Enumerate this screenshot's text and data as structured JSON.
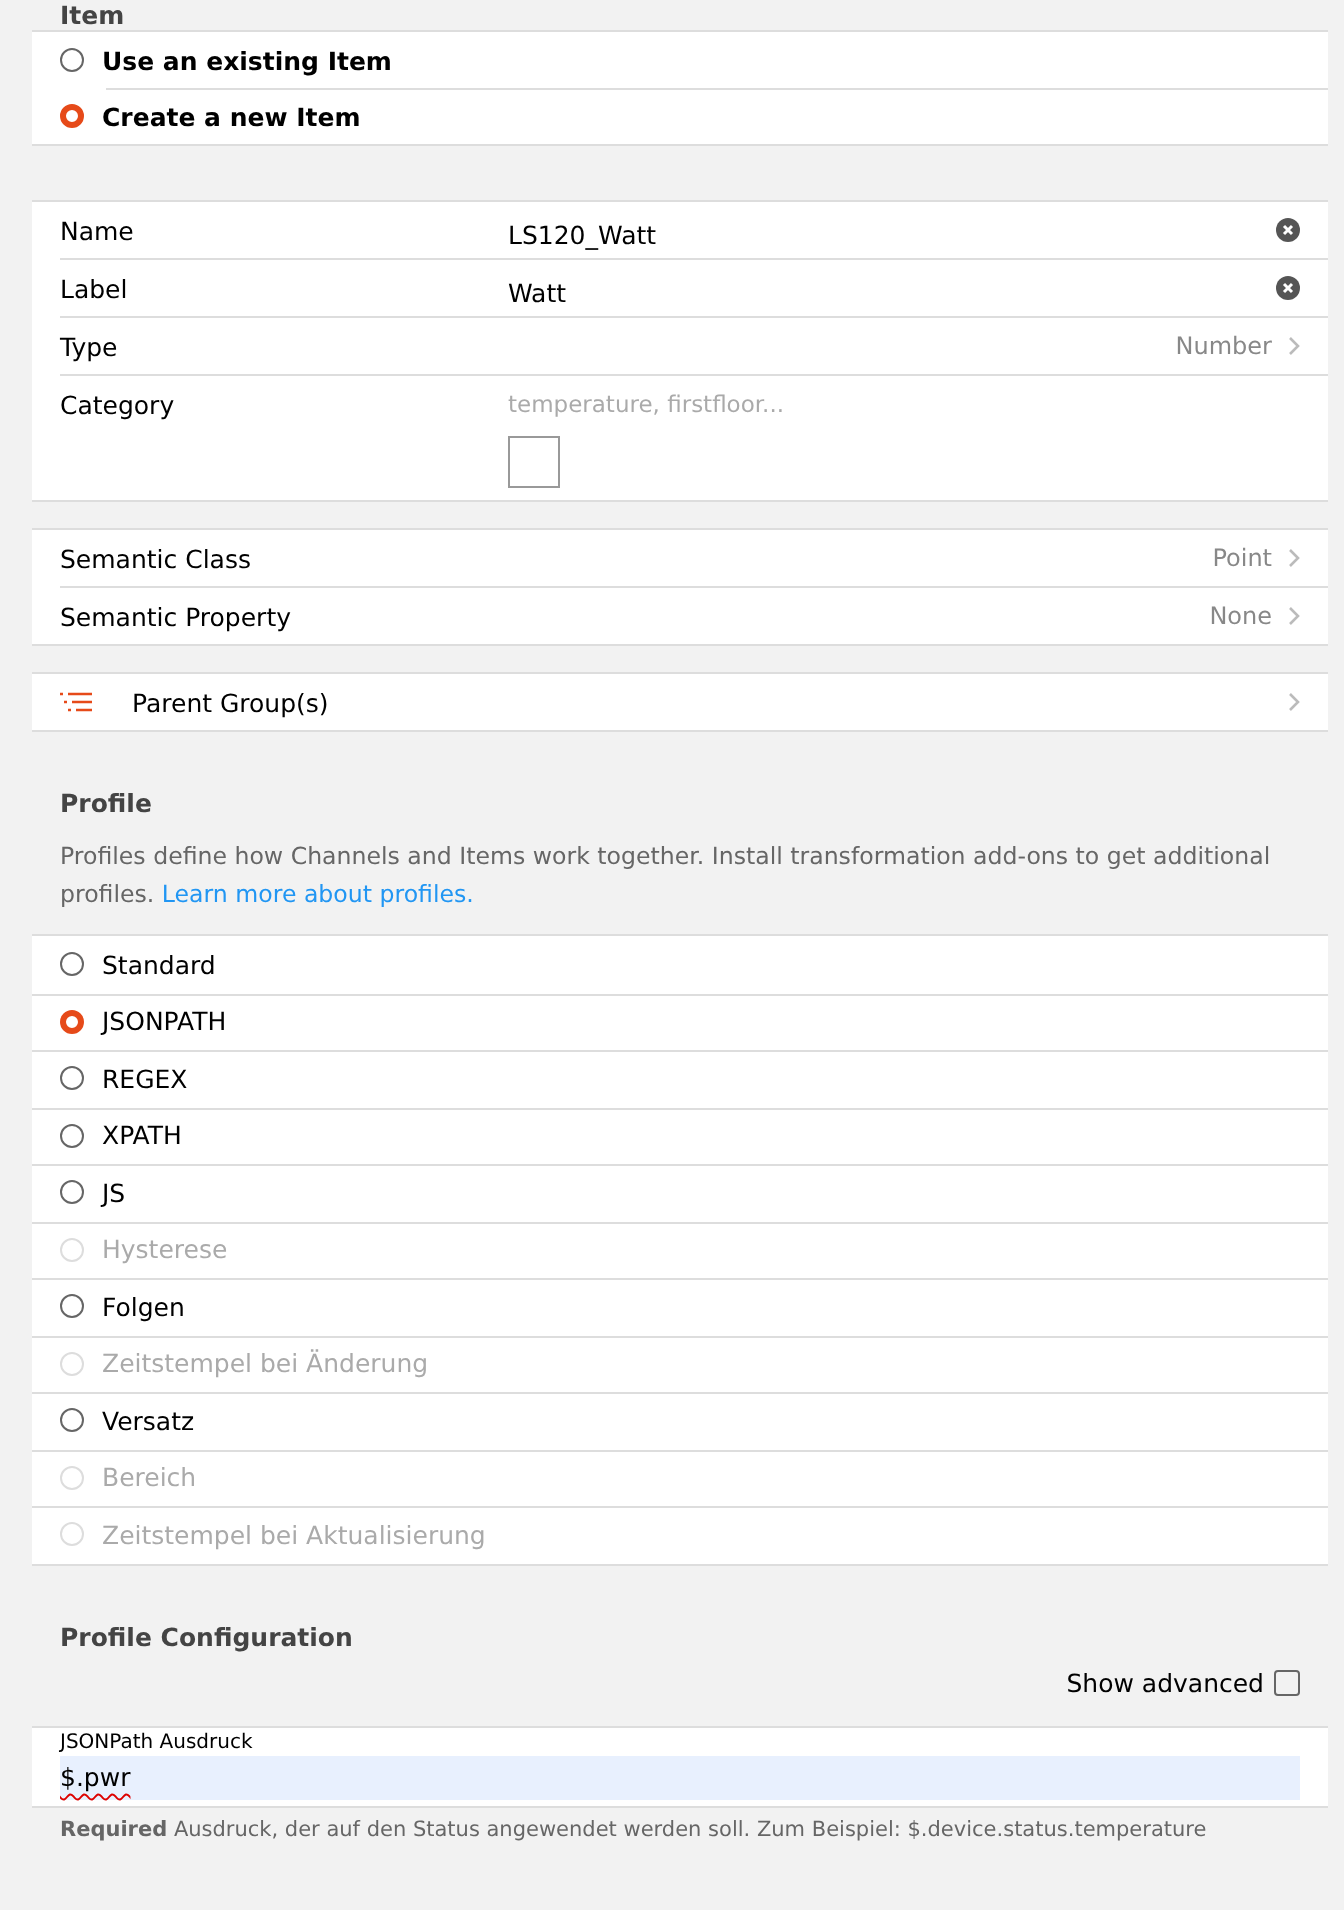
{
  "item_section": {
    "title": "Item",
    "options": [
      {
        "label": "Use an existing Item",
        "selected": false
      },
      {
        "label": "Create a new Item",
        "selected": true
      }
    ]
  },
  "item_fields": [
    {
      "kind": "input",
      "label": "Name",
      "value": "LS120_Watt"
    },
    {
      "kind": "input",
      "label": "Label",
      "value": "Watt"
    },
    {
      "kind": "select",
      "label": "Type",
      "value": "Number"
    },
    {
      "kind": "category",
      "label": "Category",
      "placeholder": "temperature, firstfloor..."
    }
  ],
  "semantic_fields": [
    {
      "label": "Semantic Class",
      "value": "Point"
    },
    {
      "label": "Semantic Property",
      "value": "None"
    }
  ],
  "parent_groups": {
    "label": "Parent Group(s)"
  },
  "profile": {
    "title": "Profile",
    "description": "Profiles define how Channels and Items work together. Install transformation add-ons to get additional profiles.",
    "link": "Learn more about profiles.",
    "options": [
      {
        "label": "Standard",
        "selected": false,
        "disabled": false
      },
      {
        "label": "JSONPATH",
        "selected": true,
        "disabled": false
      },
      {
        "label": "REGEX",
        "selected": false,
        "disabled": false
      },
      {
        "label": "XPATH",
        "selected": false,
        "disabled": false
      },
      {
        "label": "JS",
        "selected": false,
        "disabled": false
      },
      {
        "label": "Hysterese",
        "selected": false,
        "disabled": true
      },
      {
        "label": "Folgen",
        "selected": false,
        "disabled": false
      },
      {
        "label": "Zeitstempel bei Änderung",
        "selected": false,
        "disabled": true
      },
      {
        "label": "Versatz",
        "selected": false,
        "disabled": false
      },
      {
        "label": "Bereich",
        "selected": false,
        "disabled": true
      },
      {
        "label": "Zeitstempel bei Aktualisierung",
        "selected": false,
        "disabled": true
      }
    ]
  },
  "profile_configuration": {
    "title": "Profile Configuration",
    "show_advanced": {
      "label": "Show advanced",
      "checked": false
    },
    "field": {
      "label": "JSONPath Ausdruck",
      "value": "$.pwr"
    },
    "hint": "**Required** Ausdruck, der auf den Status angewendet werden soll. Zum Beispiel: $.device.status.temperature"
  }
}
